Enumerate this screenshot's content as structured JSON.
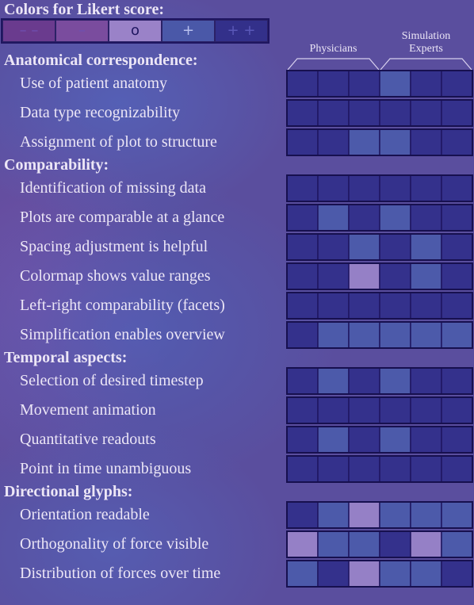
{
  "chart_data": {
    "type": "heatmap",
    "title": "Colors for Likert score:",
    "legend": {
      "labels": [
        "– –",
        "–",
        "o",
        "+",
        "+ +"
      ],
      "colors": [
        "#6a3b8e",
        "#7a4c9e",
        "#9a82c8",
        "#4a58a8",
        "#33308a"
      ]
    },
    "group_labels": [
      "Physicians",
      "Simulation Experts"
    ],
    "columns_per_group": 3,
    "sections": [
      {
        "title": "Anatomical correspondence:",
        "items": [
          {
            "label": "Use of patient anatomy",
            "scores": [
              2,
              2,
              2,
              1,
              2,
              2
            ]
          },
          {
            "label": "Data type recognizability",
            "scores": [
              2,
              2,
              2,
              2,
              2,
              2
            ]
          },
          {
            "label": "Assignment of plot to structure",
            "scores": [
              2,
              2,
              1,
              1,
              2,
              2
            ]
          }
        ]
      },
      {
        "title": "Comparability:",
        "items": [
          {
            "label": "Identification of missing data",
            "scores": [
              2,
              2,
              2,
              2,
              2,
              2
            ]
          },
          {
            "label": "Plots are comparable at a glance",
            "scores": [
              2,
              1,
              2,
              1,
              2,
              2
            ]
          },
          {
            "label": "Spacing adjustment is helpful",
            "scores": [
              2,
              2,
              1,
              2,
              1,
              2
            ]
          },
          {
            "label": "Colormap shows value ranges",
            "scores": [
              2,
              2,
              0,
              2,
              1,
              2
            ]
          },
          {
            "label": "Left-right comparability (facets)",
            "scores": [
              2,
              2,
              2,
              2,
              2,
              2
            ]
          },
          {
            "label": "Simplification enables overview",
            "scores": [
              2,
              1,
              1,
              1,
              1,
              1
            ]
          }
        ]
      },
      {
        "title": "Temporal aspects:",
        "items": [
          {
            "label": "Selection of desired timestep",
            "scores": [
              2,
              1,
              2,
              1,
              2,
              2
            ]
          },
          {
            "label": "Movement animation",
            "scores": [
              2,
              2,
              2,
              2,
              2,
              2
            ]
          },
          {
            "label": "Quantitative readouts",
            "scores": [
              2,
              1,
              2,
              1,
              2,
              2
            ]
          },
          {
            "label": "Point in time unambiguous",
            "scores": [
              2,
              2,
              2,
              2,
              2,
              2
            ]
          }
        ]
      },
      {
        "title": "Directional glyphs:",
        "items": [
          {
            "label": "Orientation readable",
            "scores": [
              2,
              1,
              0,
              1,
              1,
              1
            ]
          },
          {
            "label": "Orthogonality of force visible",
            "scores": [
              0,
              1,
              1,
              2,
              0,
              1
            ]
          },
          {
            "label": "Distribution of forces over time",
            "scores": [
              1,
              2,
              0,
              1,
              1,
              2
            ]
          }
        ]
      }
    ],
    "score_scale": {
      "0": "o",
      "1": "+",
      "2": "+ +"
    },
    "cell_colors": {
      "0": "#9580c6",
      "1": "#4c5aaa",
      "2": "#34318c"
    }
  }
}
